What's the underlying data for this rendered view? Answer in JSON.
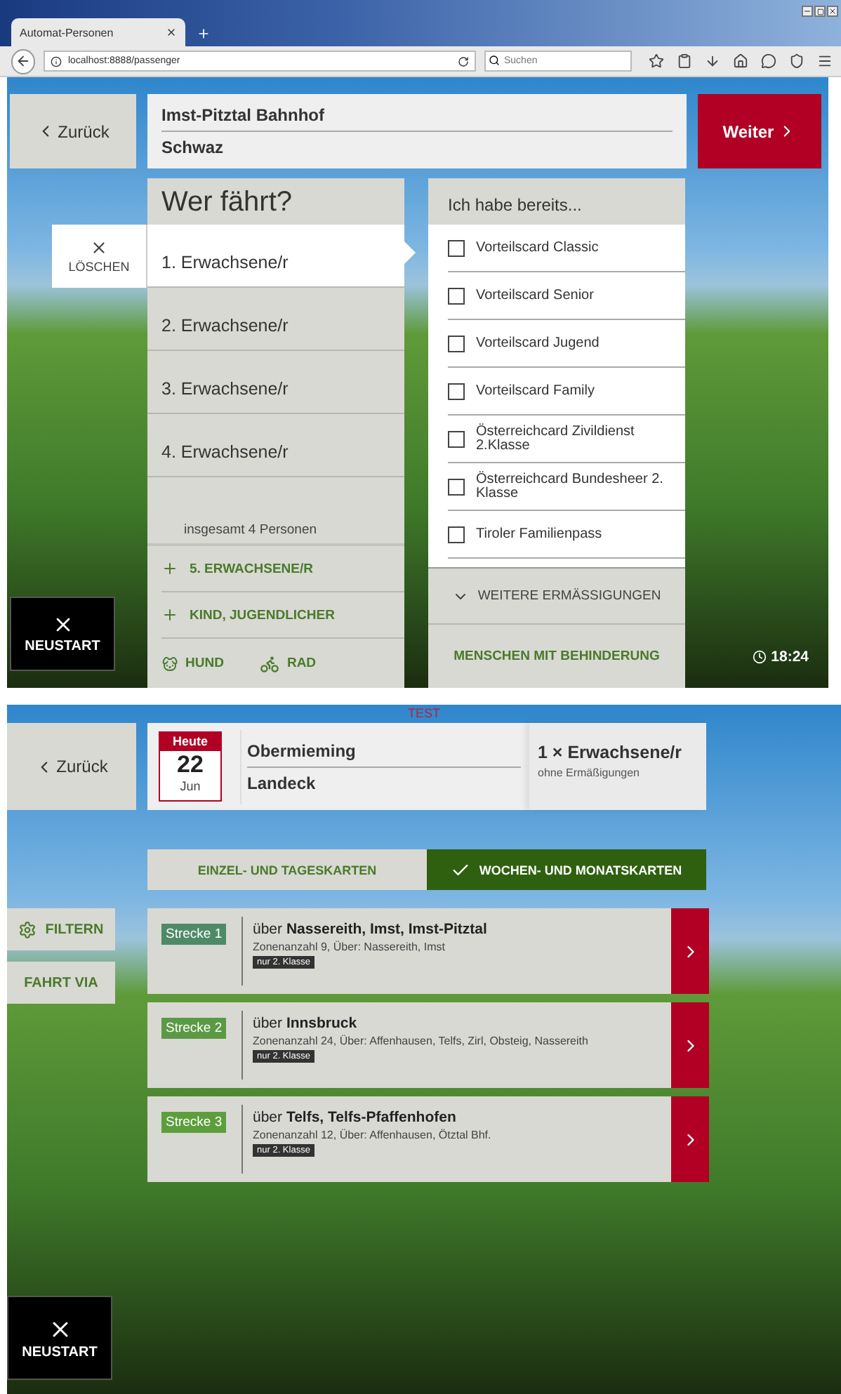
{
  "browser": {
    "tab_title": "Automat-Personen",
    "address": "localhost:8888/passenger",
    "search": {
      "placeholder": "Suchen"
    }
  },
  "screen_passengers": {
    "back": "Zurück",
    "route": {
      "from": "Imst-Pitztal Bahnhof",
      "to": "Schwaz"
    },
    "next": "Weiter",
    "passengers": {
      "title": "Wer fährt?",
      "delete": "LÖSCHEN",
      "rows": [
        {
          "label": "1.  Erwachsene/r",
          "selected": true
        },
        {
          "label": "2.  Erwachsene/r",
          "selected": false
        },
        {
          "label": "3.  Erwachsene/r",
          "selected": false
        },
        {
          "label": "4.  Erwachsene/r",
          "selected": false
        }
      ],
      "total": "insgesamt 4 Personen",
      "add": [
        {
          "label": "5. ERWACHSENE/R"
        },
        {
          "label": "KIND, JUGENDLICHER"
        }
      ],
      "extras": [
        {
          "kind": "dog",
          "label": "HUND"
        },
        {
          "kind": "bike",
          "label": "RAD"
        }
      ]
    },
    "discounts": {
      "title": "Ich habe bereits...",
      "items": [
        {
          "label": "Vorteilscard Classic",
          "checked": false
        },
        {
          "label": "Vorteilscard Senior",
          "checked": false
        },
        {
          "label": "Vorteilscard Jugend",
          "checked": false
        },
        {
          "label": "Vorteilscard Family",
          "checked": false
        },
        {
          "label": "Österreichcard Zivildienst 2.Klasse",
          "checked": false
        },
        {
          "label": "Österreichcard Bundesheer 2. Klasse",
          "checked": false
        },
        {
          "label": "Tiroler Familienpass",
          "checked": false
        }
      ],
      "more": "WEITERE ERMÄSSIGUNGEN",
      "disability": "MENSCHEN MIT BEHINDERUNG"
    },
    "restart": "NEUSTART",
    "clock": "18:24"
  },
  "test_label": "TEST",
  "screen_routes": {
    "back": "Zurück",
    "date": {
      "label": "Heute",
      "day": "22",
      "month": "Jun"
    },
    "from": "Obermieming",
    "to": "Landeck",
    "passengers": "1 × Erwachsene/r",
    "discounts": "ohne Ermäßigungen",
    "tabs": [
      {
        "label": "EINZEL- UND TAGESKARTEN",
        "selected": false
      },
      {
        "label": "WOCHEN- UND MONATSKARTEN",
        "selected": true
      }
    ],
    "side_buttons": [
      {
        "kind": "filter",
        "label": "FILTERN"
      },
      {
        "kind": "via",
        "label": "FAHRT VIA"
      }
    ],
    "routes": [
      {
        "badge": "Strecke 1",
        "color": "#4e8a66",
        "via": "über **Nassereith, Imst, Imst-Pitztal**",
        "zones": "Zonenanzahl 9, Über: Nassereith, Imst",
        "class": "nur 2. Klasse"
      },
      {
        "badge": "Strecke 2",
        "color": "#5a9a44",
        "via": "über **Innsbruck**",
        "zones": "Zonenanzahl 24, Über: Affenhausen, Telfs, Zirl, Obsteig, Nassereith",
        "class": "nur 2. Klasse"
      },
      {
        "badge": "Strecke 3",
        "color": "#5c9e3c",
        "via": "über **Telfs, Telfs-Pfaffenhofen**",
        "zones": "Zonenanzahl 12, Über: Affenhausen, Ötztal Bhf.",
        "class": "nur 2. Klasse"
      }
    ],
    "restart": "NEUSTART"
  }
}
